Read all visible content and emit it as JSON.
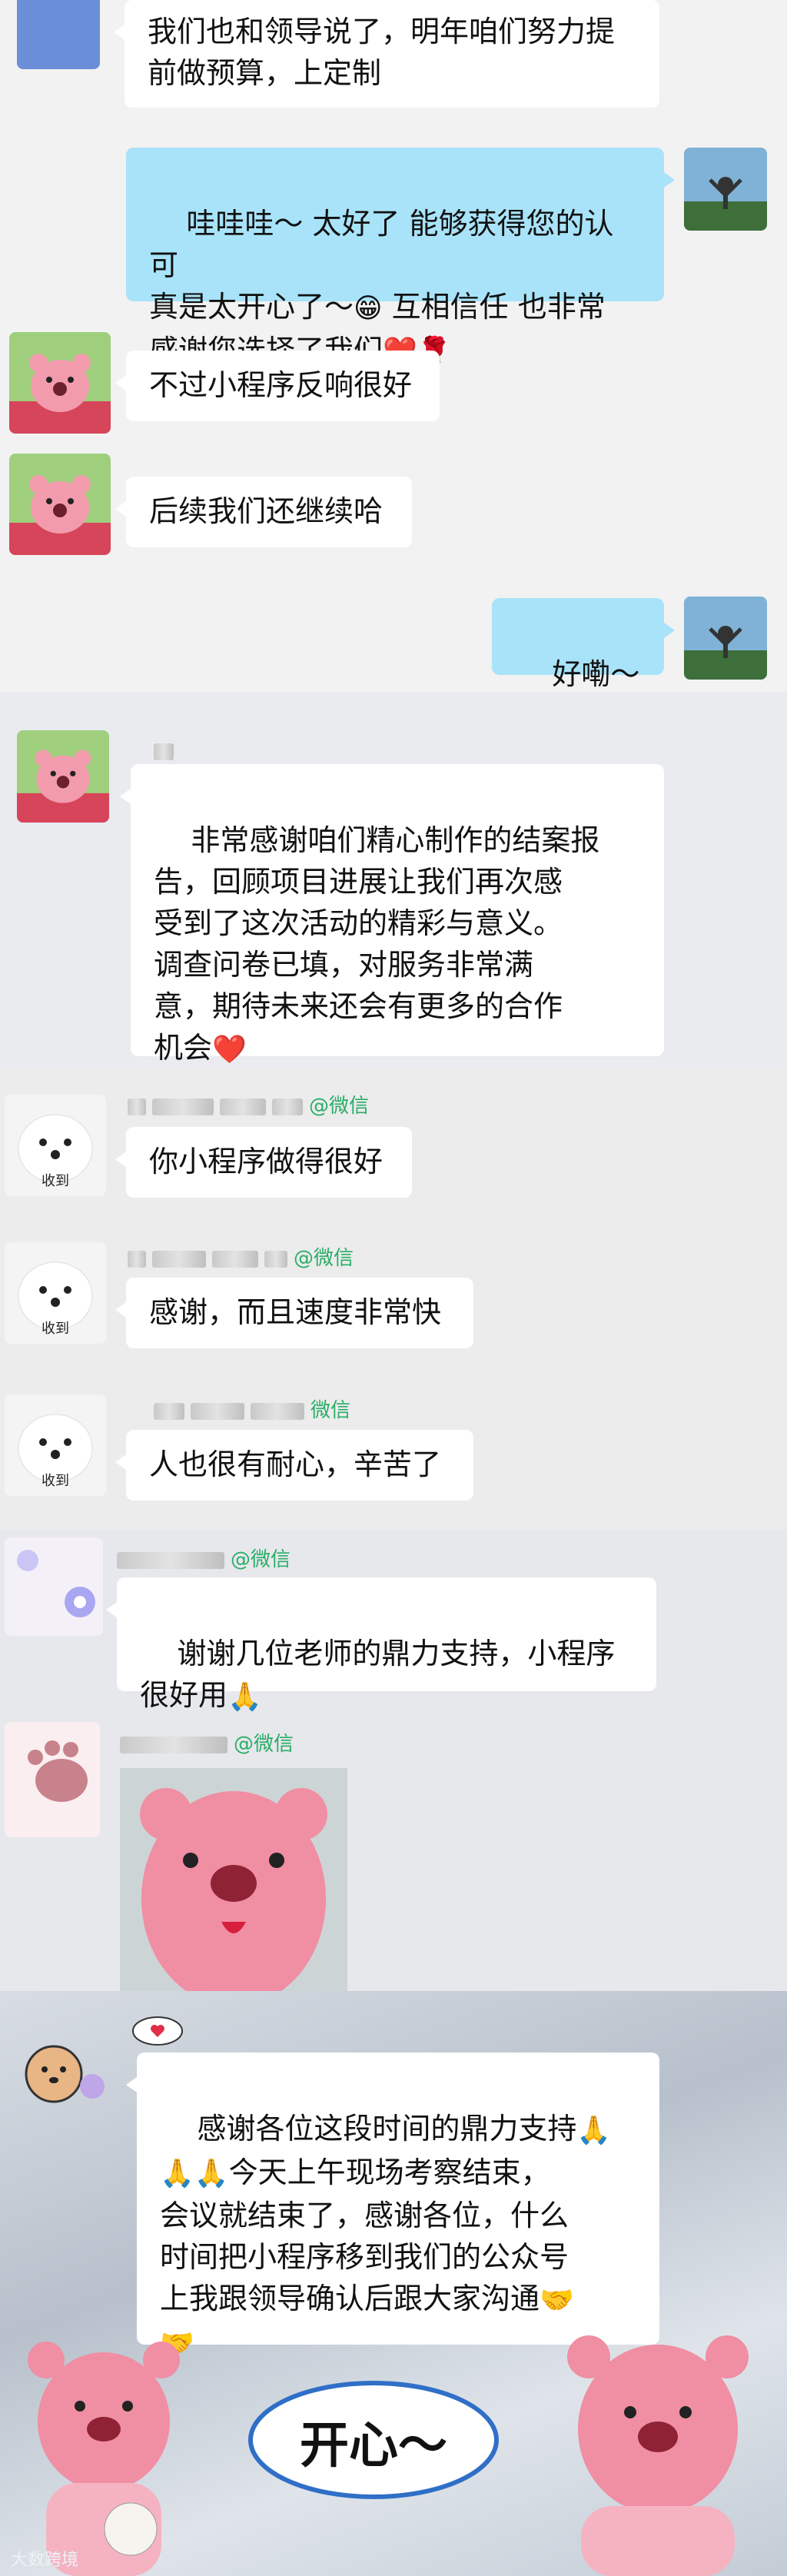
{
  "chat_a": {
    "msg_1": "我们也和领导说了，明年咱们努力提\n前做预算，上定制",
    "msg_2_text": "哇哇哇～ 太好了 能够获得您的认可\n真是太开心了～",
    "msg_2_text_b": " 互相信任 也非常\n感谢您选择了我们",
    "msg_3": "不过小程序反响很好",
    "msg_4": "后续我们还继续哈",
    "msg_5": "好嘞～"
  },
  "chat_b": {
    "msg_1": "非常感谢咱们精心制作的结案报\n告，回顾项目进展让我们再次感\n受到了这次活动的精彩与意义。\n调查问卷已填，对服务非常满\n意，期待未来还会有更多的合作\n机会"
  },
  "chat_c": {
    "wechat_tag": "@微信",
    "wechat_tag_plain": "微信",
    "msg_1": "你小程序做得很好",
    "msg_2": "感谢，而且速度非常快",
    "msg_3": "人也很有耐心，辛苦了",
    "sticker_text": "收到"
  },
  "chat_d": {
    "wechat_tag": "@微信",
    "msg_1": "谢谢几位老师的鼎力支持，小程序\n很好用"
  },
  "chat_e": {
    "msg_1": "感谢各位这段时间的鼎力支持",
    "msg_1b": "今天上午现场考察结束，\n会议就结束了，感谢各位，什么\n时间把小程序移到我们的公众号\n上我跟领导确认后跟大家沟通",
    "sticker_text": "开心～",
    "watermark": "大数跨境"
  },
  "colors": {
    "my_bubble": "#a8e3f9",
    "bubble": "#ffffff",
    "wechat_green": "#2aae67"
  },
  "icons": [
    "loopy-avatar",
    "beach-avatar",
    "dog-avatar",
    "heart-emoji",
    "rose-emoji",
    "pray-emoji",
    "handshake-emoji",
    "grin-emoji",
    "blush-emoji"
  ]
}
